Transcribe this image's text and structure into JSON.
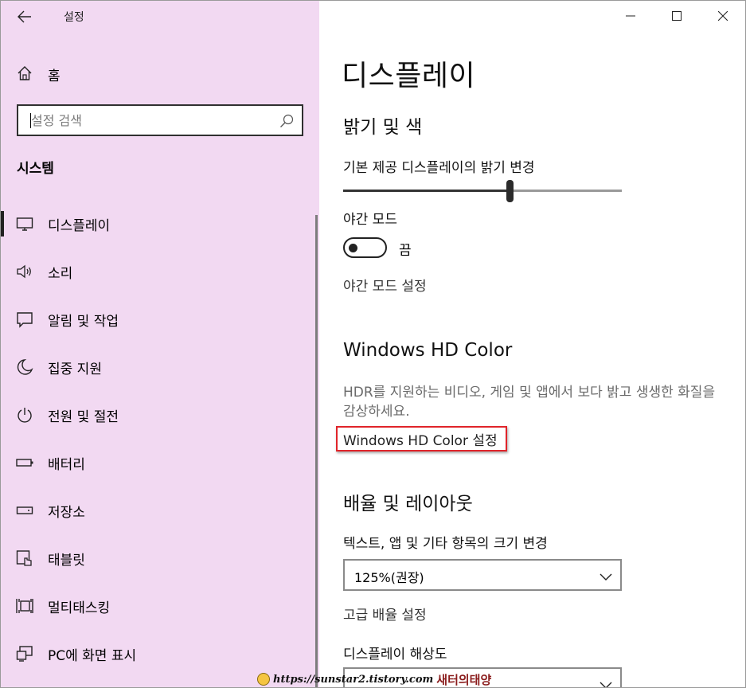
{
  "window": {
    "title": "설정"
  },
  "sidebar": {
    "home_label": "홈",
    "search_placeholder": "설정 검색",
    "section_title": "시스템",
    "items": [
      {
        "label": "디스플레이",
        "icon": "monitor-icon",
        "selected": true
      },
      {
        "label": "소리",
        "icon": "speaker-icon"
      },
      {
        "label": "알림 및 작업",
        "icon": "message-icon"
      },
      {
        "label": "집중 지원",
        "icon": "moon-icon"
      },
      {
        "label": "전원 및 절전",
        "icon": "power-icon"
      },
      {
        "label": "배터리",
        "icon": "battery-icon"
      },
      {
        "label": "저장소",
        "icon": "storage-icon"
      },
      {
        "label": "태블릿",
        "icon": "tablet-icon"
      },
      {
        "label": "멀티태스킹",
        "icon": "multitasking-icon"
      },
      {
        "label": "PC에 화면 표시",
        "icon": "project-icon"
      }
    ]
  },
  "main": {
    "title": "디스플레이",
    "brightness": {
      "heading": "밝기 및 색",
      "slider_label": "기본 제공 디스플레이의 밝기 변경",
      "slider_value": 0.6
    },
    "night_light": {
      "label": "야간 모드",
      "state": "끔",
      "on": false,
      "settings_link": "야간 모드 설정"
    },
    "hd_color": {
      "heading": "Windows HD Color",
      "description": "HDR를 지원하는 비디오, 게임 및 앱에서 보다 밝고 생생한 화질을 감상하세요.",
      "settings_link": "Windows HD Color 설정"
    },
    "scale_layout": {
      "heading": "배율 및 레이아웃",
      "scale_label": "텍스트, 앱 및 기타 항목의 크기 변경",
      "scale_value": "125%(권장)",
      "advanced_link": "고급 배율 설정",
      "resolution_label": "디스플레이 해상도"
    }
  },
  "watermark": {
    "url": "https://sunstar2.tistory.com",
    "name": "새터의태양"
  },
  "colors": {
    "sidebar_bg": "#f2d9f2",
    "highlight_box": "#e0242a"
  }
}
